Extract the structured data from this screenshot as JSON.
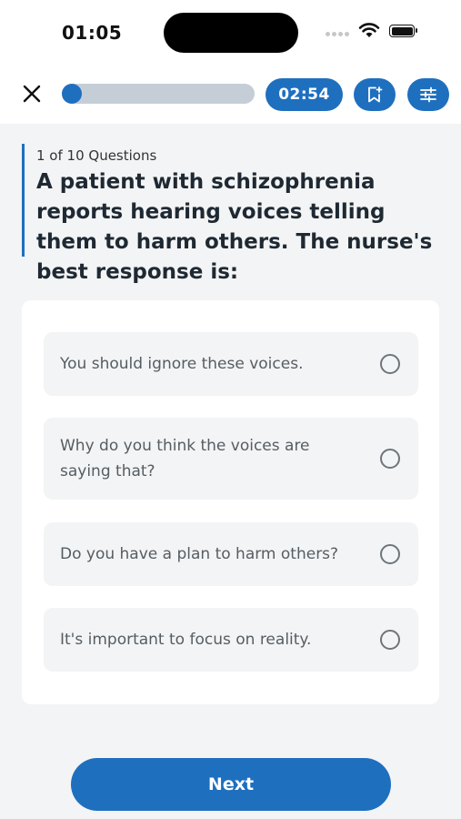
{
  "status_bar": {
    "time": "01:05"
  },
  "header": {
    "progress_fraction": 0.1,
    "timer": "02:54",
    "icons": [
      "close-icon",
      "bookmark-add-icon",
      "sliders-icon"
    ]
  },
  "question": {
    "counter": "1 of 10 Questions",
    "text": "A patient with schizophrenia reports hearing voices telling them to harm others. The nurse's best response is:"
  },
  "options": [
    {
      "label": "You should ignore these voices."
    },
    {
      "label": "Why do you think the voices are saying that?"
    },
    {
      "label": "Do you have a plan to harm others?"
    },
    {
      "label": "It's important to focus on reality."
    }
  ],
  "footer": {
    "next_label": "Next"
  },
  "colors": {
    "accent": "#1f6fbf",
    "track": "#c5ced6",
    "background": "#f3f4f5"
  }
}
